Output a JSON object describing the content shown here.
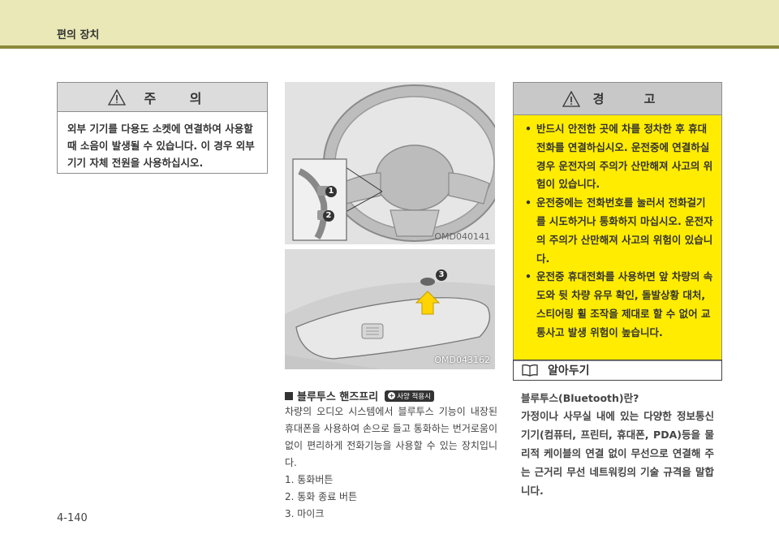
{
  "header": {
    "title": "편의 장치"
  },
  "caution": {
    "title": "주 의",
    "text": "외부 기기를 다용도 소켓에 연결하여 사용할 때 소음이 발생될 수 있습니다. 이 경우 외부 기기 자체 전원을 사용하십시오."
  },
  "figures": {
    "fig1_code": "OMD040141",
    "fig2_code": "OMD043162",
    "callout_1": "1",
    "callout_2": "2",
    "callout_3": "3"
  },
  "bluetooth": {
    "heading": "블루투스 핸즈프리",
    "badge": "사양 적용시",
    "paragraph": "차량의 오디오 시스템에서 블루투스 기능이 내장된 휴대폰을 사용하여 손으로 들고 통화하는 번거로움이 없이 편리하게 전화기능을 사용할 수 있는 장치입니다.",
    "items": [
      "1.  통화버튼",
      "2.  통화 종료 버튼",
      "3.  마이크"
    ]
  },
  "warning": {
    "title": "경 고",
    "items": [
      "반드시 안전한 곳에 차를 정차한 후 휴대전화를 연결하십시오. 운전중에 연결하실 경우 운전자의 주의가 산만해져 사고의 위험이 있습니다.",
      "운전중에는 전화번호를 눌러서 전화걸기를 시도하거나 통화하지 마십시오. 운전자의 주의가 산만해져 사고의 위험이 있습니다.",
      "운전중 휴대전화를 사용하면 앞 차량의 속도와 뒷 차량 유무 확인, 돌발상황 대처, 스티어링 휠 조작을 제대로 할 수 없어 교통사고 발생 위험이 높습니다."
    ]
  },
  "note": {
    "title": "알아두기",
    "question": "블루투스(Bluetooth)란?",
    "body": "가정이나 사무실 내에 있는 다양한 정보통신 기기(컴퓨터, 프린터, 휴대폰, PDA)등을 물리적 케이블의 연결 없이 무선으로 연결해 주는 근거리 무선 네트워킹의 기술 규격을 말합니다."
  },
  "footer": {
    "page_number": "4-140"
  }
}
